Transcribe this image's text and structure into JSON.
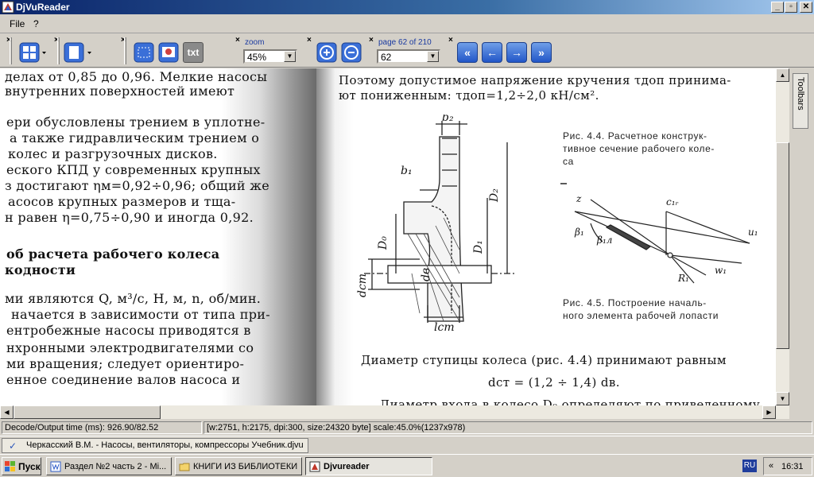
{
  "window": {
    "title": "DjVuReader",
    "buttons": {
      "minimize": "_",
      "maximize": "▫",
      "close": "✕"
    }
  },
  "menu": {
    "items": [
      "File",
      "?"
    ]
  },
  "toolbar": {
    "close_glyph": "×",
    "txt_label": "txt",
    "zoom": {
      "caption": "zoom",
      "value": "45%"
    },
    "page": {
      "caption": "page 62 of 210",
      "value": "62"
    },
    "nav": {
      "first": "«",
      "prev": "←",
      "next": "→",
      "last": "»"
    }
  },
  "document": {
    "left_lines": [
      "делах от 0,85 до 0,96. Мелкие насосы",
      "внутренних   поверхностей   имеют",
      "ери обусловлены трением в уплотне-",
      "а также гидравлическим трением о",
      "колес и разгрузочных дисков.",
      "еского КПД у современных крупных",
      "з достигают ηм=0,92÷0,96; общий же",
      "асосов  крупных  размеров  и  тща-",
      "н равен η=0,75÷0,90 и иногда 0,92.",
      "об расчета рабочего колеса",
      "кодности",
      "ми являются Q, м³/с, H, м, n, об/мин.",
      "начается в зависимости от типа при-",
      "ентробежные насосы приводятся   в",
      "нхронными  электродвигателями  со",
      "ми вращения;  следует  ориентиро-",
      "енное соединение  валов  насоса   и"
    ],
    "right_lines": [
      "Поэтому допустимое напряжение кручения τдоп принима-",
      "ют пониженным: τдоп=1,2÷2,0 кН/см².",
      "Диаметр ступицы колеса (рис. 4.4) принимают равным",
      "dст = (1,2 ÷ 1,4) dв.",
      "Диаметр входа в колесо  D₀  определяют по приведенному"
    ],
    "caption_4_4": [
      "Рис. 4.4. Расчетное конструк-",
      "тивное сечение рабочего коле-",
      "са"
    ],
    "caption_4_5": [
      "Рис.  4.5.  Построение  началь-",
      "ного элемента рабочей лопасти"
    ],
    "fig_labels": {
      "b2": "b₂",
      "d1": "b₁",
      "D2": "D₂",
      "D0": "D₀",
      "D1": "D₁",
      "dst": "dст",
      "db": "dв",
      "lst": "lст",
      "c1r": "c₁ᵣ",
      "beta1": "β₁",
      "beta1l": "β₁л",
      "u1": "u₁",
      "w1": "w₁",
      "R1": "R₁",
      "z": "z"
    }
  },
  "sidebar": {
    "toolbars_label": "Toolbars"
  },
  "status": {
    "decode_time": "Decode/Output time (ms): 926.90/82.52",
    "info": "[w:2751, h:2175, dpi:300, size:24320 byte] scale:45.0%(1237x978)"
  },
  "document_tab": {
    "label": "Черкасский В.М. - Насосы, вентиляторы, компрессоры Учебник.djvu"
  },
  "taskbar": {
    "start_label": "Пуск",
    "tasks": [
      "Раздел №2 часть 2 - Mi...",
      "КНИГИ ИЗ БИБЛИОТЕКИ",
      "Djvureader"
    ],
    "lang": "RU",
    "clock": "16:31",
    "tray_chevron": "«"
  }
}
